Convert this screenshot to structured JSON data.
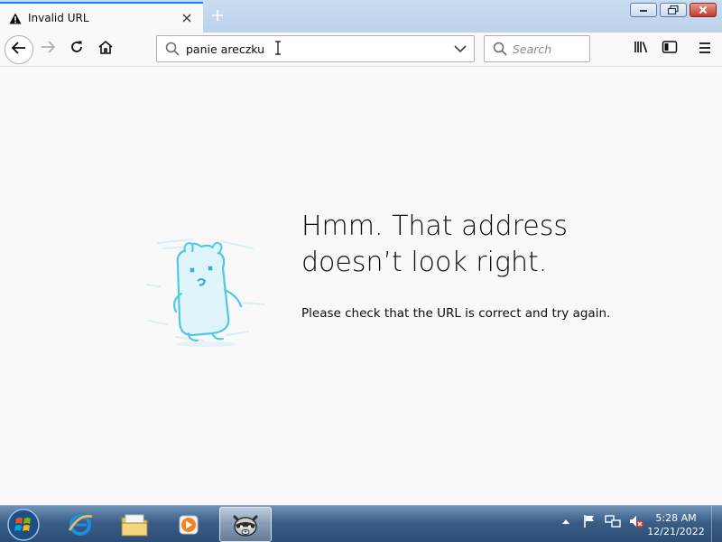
{
  "tab": {
    "title": "Invalid URL",
    "icon": "warning-icon",
    "close_icon": "close-icon"
  },
  "new_tab_icon": "plus-icon",
  "window_controls": [
    "minimize-icon",
    "restore-icon",
    "close-icon"
  ],
  "nav": {
    "back_icon": "arrow-left-icon",
    "forward_icon": "arrow-right-icon",
    "reload_icon": "reload-icon",
    "home_icon": "home-icon"
  },
  "urlbar": {
    "value": "panie areczku",
    "icon": "search-icon",
    "dropdown_icon": "chevron-down-icon"
  },
  "searchbar": {
    "placeholder": "Search",
    "icon": "search-icon"
  },
  "toolbar_right": [
    "library-icon",
    "sidebar-icon",
    "menu-icon"
  ],
  "error_page": {
    "headline_line1": "Hmm. That address",
    "headline_line2": "doesn’t look right.",
    "message": "Please check that the URL is correct and try again.",
    "illustration": "confused-dino-illustration"
  },
  "taskbar": {
    "start_icon": "windows-start-icon",
    "items": [
      "internet-explorer-icon",
      "file-explorer-icon",
      "media-player-icon",
      "firefox-raccoon-icon"
    ],
    "active_item": "firefox-raccoon-icon",
    "tray_icons": [
      "show-hidden-icons-icon",
      "action-center-flag-icon",
      "network-icon",
      "volume-muted-icon"
    ],
    "clock_time": "5:28 AM",
    "clock_date": "12/21/2022"
  },
  "colors": {
    "accent": "#0a84ff",
    "page_bg": "#f9f9fa",
    "text": "#0c0c0d",
    "taskbar": "#2c4e76"
  }
}
